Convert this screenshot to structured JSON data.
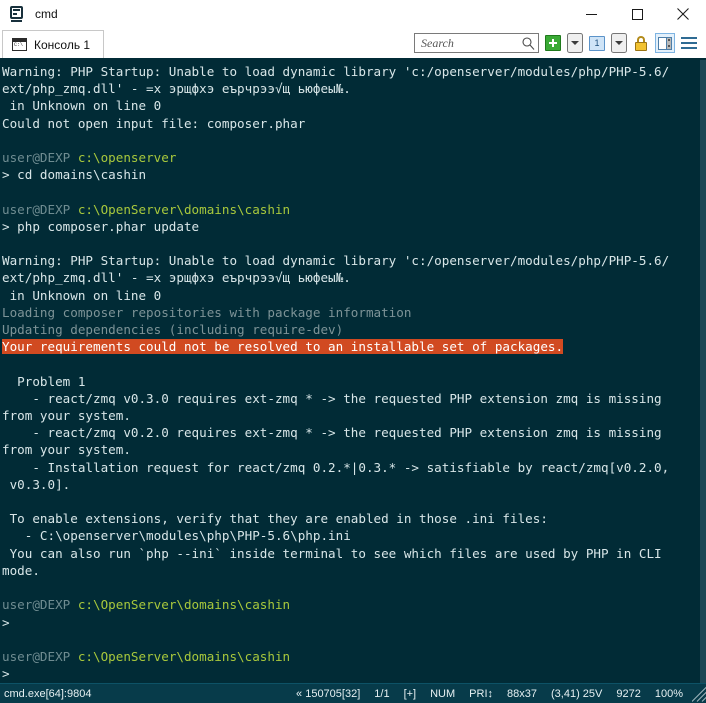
{
  "window": {
    "title": "cmd",
    "icon": "console-app-icon",
    "minimize_label": "Minimize",
    "maximize_label": "Maximize",
    "close_label": "Close"
  },
  "tabs": [
    {
      "label": "Консоль 1",
      "icon": "cmd-console-icon",
      "active": true
    }
  ],
  "toolbar": {
    "search": {
      "placeholder": "Search",
      "value": "",
      "icon": "search-icon"
    },
    "new_tab": {
      "label": "New tab",
      "icon": "green-plus-icon"
    },
    "new_tab_dropdown": {
      "label": "New tab options",
      "icon": "chevron-down-icon"
    },
    "tab_select": {
      "label": "1",
      "icon": "tab-number-icon"
    },
    "tab_select_dropdown": {
      "label": "Tab list",
      "icon": "chevron-down-icon"
    },
    "lock": {
      "label": "Lock",
      "icon": "padlock-icon"
    },
    "panel_toggle": {
      "label": "Toggle side panel",
      "icon": "split-panel-icon",
      "active": true
    },
    "menu": {
      "label": "Menu",
      "icon": "hamburger-menu-icon"
    }
  },
  "terminal": {
    "lines": [
      {
        "segments": [
          {
            "text": "Warning: PHP Startup: Unable to load dynamic library 'c:/openserver/modules/php/PHP-5.6/",
            "style": "default"
          }
        ]
      },
      {
        "segments": [
          {
            "text": "ext/php_zmq.dll' - =x эрщфхэ еърчрээ√щ ьюфеы№.",
            "style": "default"
          }
        ]
      },
      {
        "segments": [
          {
            "text": " in Unknown on line 0",
            "style": "default"
          }
        ]
      },
      {
        "segments": [
          {
            "text": "Could not open input file: composer.phar",
            "style": "default"
          }
        ]
      },
      {
        "segments": [
          {
            "text": "",
            "style": "default"
          }
        ]
      },
      {
        "segments": [
          {
            "text": "user@DEXP ",
            "style": "user"
          },
          {
            "text": "c:\\openserver",
            "style": "path"
          }
        ]
      },
      {
        "segments": [
          {
            "text": "> cd domains\\cashin",
            "style": "default"
          }
        ]
      },
      {
        "segments": [
          {
            "text": "",
            "style": "default"
          }
        ]
      },
      {
        "segments": [
          {
            "text": "user@DEXP ",
            "style": "user"
          },
          {
            "text": "c:\\OpenServer\\domains\\cashin",
            "style": "path"
          }
        ]
      },
      {
        "segments": [
          {
            "text": "> php composer.phar update",
            "style": "default"
          }
        ]
      },
      {
        "segments": [
          {
            "text": "",
            "style": "default"
          }
        ]
      },
      {
        "segments": [
          {
            "text": "Warning: PHP Startup: Unable to load dynamic library 'c:/openserver/modules/php/PHP-5.6/",
            "style": "default"
          }
        ]
      },
      {
        "segments": [
          {
            "text": "ext/php_zmq.dll' - =x эрщфхэ еърчрээ√щ ьюфеы№.",
            "style": "default"
          }
        ]
      },
      {
        "segments": [
          {
            "text": " in Unknown on line 0",
            "style": "default"
          }
        ]
      },
      {
        "segments": [
          {
            "text": "Loading composer repositories with package information",
            "style": "dim"
          }
        ]
      },
      {
        "segments": [
          {
            "text": "Updating dependencies (including require-dev)",
            "style": "dim"
          }
        ]
      },
      {
        "segments": [
          {
            "text": "Your requirements could not be resolved to an installable set of packages.",
            "style": "error"
          }
        ]
      },
      {
        "segments": [
          {
            "text": "",
            "style": "default"
          }
        ]
      },
      {
        "segments": [
          {
            "text": "  Problem 1",
            "style": "default"
          }
        ]
      },
      {
        "segments": [
          {
            "text": "    - react/zmq v0.3.0 requires ext-zmq * -> the requested PHP extension zmq is missing",
            "style": "default"
          }
        ]
      },
      {
        "segments": [
          {
            "text": "from your system.",
            "style": "default"
          }
        ]
      },
      {
        "segments": [
          {
            "text": "    - react/zmq v0.2.0 requires ext-zmq * -> the requested PHP extension zmq is missing",
            "style": "default"
          }
        ]
      },
      {
        "segments": [
          {
            "text": "from your system.",
            "style": "default"
          }
        ]
      },
      {
        "segments": [
          {
            "text": "    - Installation request for react/zmq 0.2.*|0.3.* -> satisfiable by react/zmq[v0.2.0,",
            "style": "default"
          }
        ]
      },
      {
        "segments": [
          {
            "text": " v0.3.0].",
            "style": "default"
          }
        ]
      },
      {
        "segments": [
          {
            "text": "",
            "style": "default"
          }
        ]
      },
      {
        "segments": [
          {
            "text": " To enable extensions, verify that they are enabled in those .ini files:",
            "style": "default"
          }
        ]
      },
      {
        "segments": [
          {
            "text": "   - C:\\openserver\\modules\\php\\PHP-5.6\\php.ini",
            "style": "default"
          }
        ]
      },
      {
        "segments": [
          {
            "text": " You can also run `php --ini` inside terminal to see which files are used by PHP in CLI",
            "style": "default"
          }
        ]
      },
      {
        "segments": [
          {
            "text": "mode.",
            "style": "default"
          }
        ]
      },
      {
        "segments": [
          {
            "text": "",
            "style": "default"
          }
        ]
      },
      {
        "segments": [
          {
            "text": "user@DEXP ",
            "style": "user"
          },
          {
            "text": "c:\\OpenServer\\domains\\cashin",
            "style": "path"
          }
        ]
      },
      {
        "segments": [
          {
            "text": ">",
            "style": "default"
          }
        ]
      },
      {
        "segments": [
          {
            "text": "",
            "style": "default"
          }
        ]
      },
      {
        "segments": [
          {
            "text": "user@DEXP ",
            "style": "user"
          },
          {
            "text": "c:\\OpenServer\\domains\\cashin",
            "style": "path"
          }
        ]
      },
      {
        "segments": [
          {
            "text": ">",
            "style": "default"
          }
        ]
      }
    ],
    "colors": {
      "background": "#012b36",
      "foreground": "#d8e6e8",
      "user": "#6f8c91",
      "path": "#a8c83c",
      "dim": "#7d9397",
      "error_bg": "#d14a21",
      "error_fg": "#ffffff"
    }
  },
  "statusbar": {
    "process": "cmd.exe[64]:9804",
    "buffer": "« 150705[32]",
    "tabs": "1/1",
    "insert": "[+]",
    "num": "NUM",
    "priority": "PRI↕",
    "size": "88x37",
    "cursor": "(3,41) 25V",
    "chars": "9272",
    "zoom": "100%",
    "resize_grip": "resize-grip-icon"
  }
}
